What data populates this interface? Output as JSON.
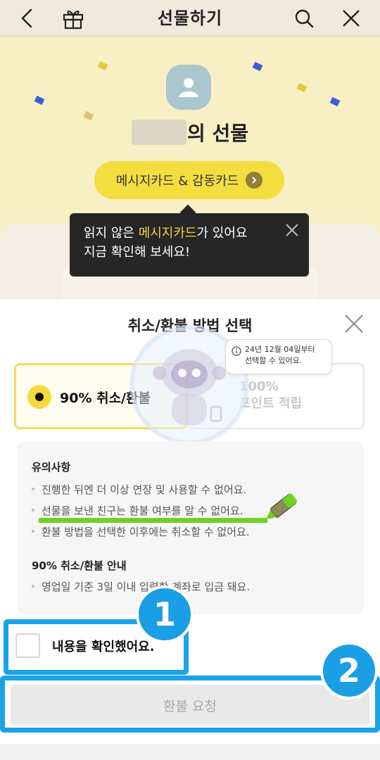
{
  "nav": {
    "title": "선물하기",
    "back_icon": "chevron-left-icon",
    "gift_icon": "gift-box-icon",
    "search_icon": "search-icon",
    "close_icon": "close-icon"
  },
  "gift_header": {
    "suffix": "의 선물",
    "card_button_label": "메시지카드 & 감동카드"
  },
  "tooltip": {
    "line1_prefix": "읽지 않은 ",
    "line1_highlight": "메시지카드",
    "line1_suffix": "가 있어요",
    "line2": "지금 확인해 보세요!"
  },
  "sheet": {
    "title": "취소/환불 방법 선택",
    "option_refund_label": "90% 취소/환불",
    "option_points_line1": "100%",
    "option_points_line2": "포인트 적립",
    "bubble_line1": "24년 12월 04일부터",
    "bubble_line2": "선택할 수 있어요.",
    "notice": {
      "heading": "유의사항",
      "items": [
        "진행한 뒤엔 더 이상 연장 및 사용할 수 없어요.",
        "선물을 보낸 친구는 환불 여부를 알 수 없어요.",
        "환불 방법을 선택한 이후에는 취소할 수 없어요."
      ],
      "guide_heading": "90% 취소/환불 안내",
      "guide_items": [
        "영업일 기준 3일 이내 입력한 계좌로 입금 돼요."
      ]
    },
    "confirm_label": "내용을 확인했어요.",
    "refund_button_label": "환불 요청"
  },
  "annotations": {
    "step1": "1",
    "step2": "2"
  },
  "colors": {
    "accent_yellow": "#f6d93c",
    "annotation_blue": "#1aa3e8",
    "highlighter_green": "#6ed21e"
  }
}
